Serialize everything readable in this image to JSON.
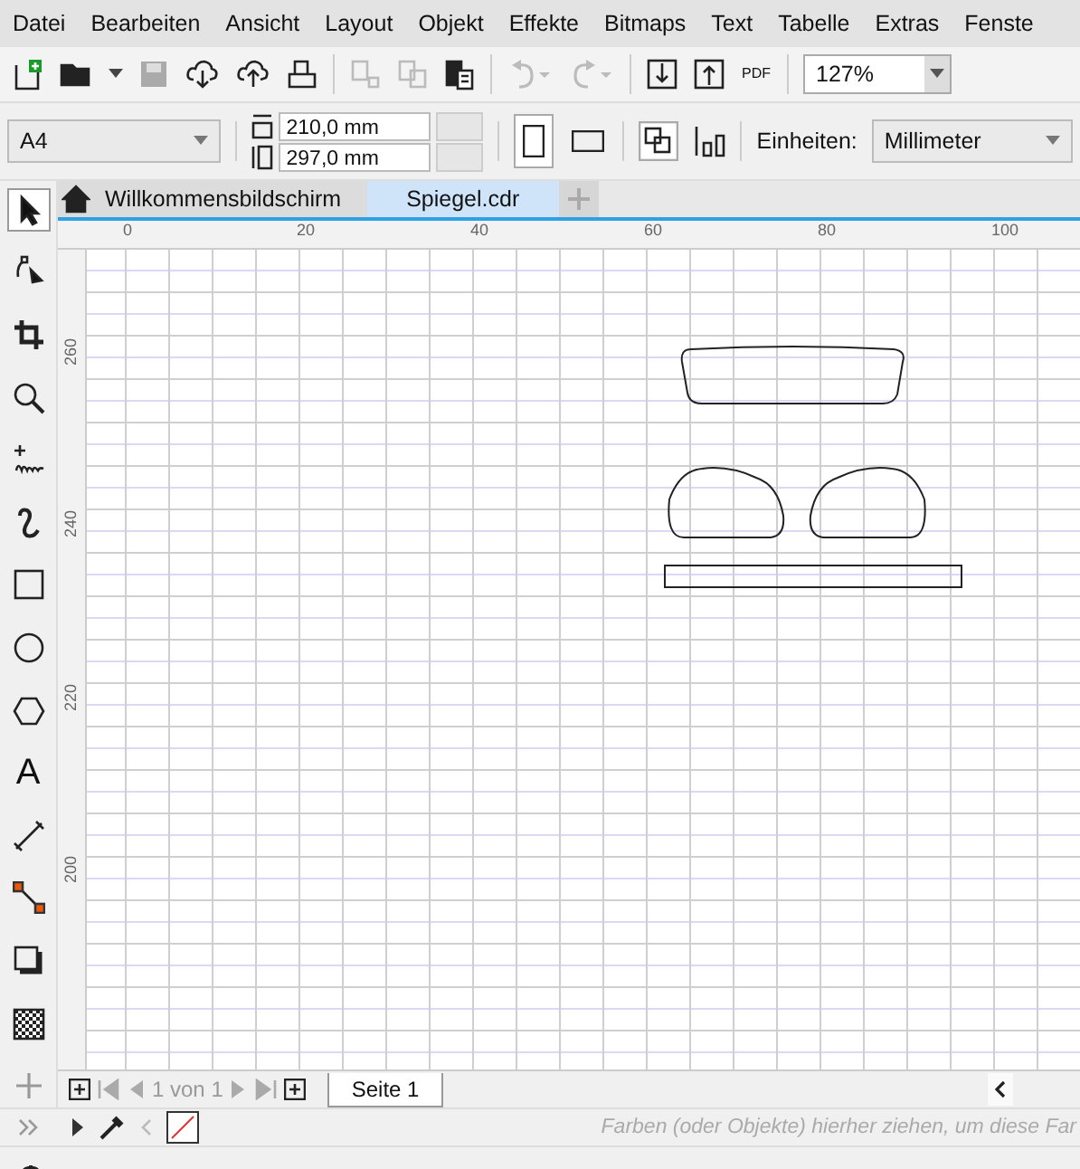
{
  "menu": [
    {
      "label": "Datei"
    },
    {
      "label": "Bearbeiten"
    },
    {
      "label": "Ansicht"
    },
    {
      "label": "Layout"
    },
    {
      "label": "Objekt"
    },
    {
      "label": "Effekte"
    },
    {
      "label": "Bitmaps"
    },
    {
      "label": "Text"
    },
    {
      "label": "Tabelle"
    },
    {
      "label": "Extras"
    },
    {
      "label": "Fenste"
    }
  ],
  "toolbar": {
    "pdf_label": "PDF",
    "zoom": "127%"
  },
  "property_bar": {
    "page_size": "A4",
    "width": "210,0 mm",
    "height": "297,0 mm",
    "orientations": [
      {
        "kind": "portrait",
        "selected": true
      },
      {
        "kind": "landscape",
        "selected": false
      }
    ],
    "units_label": "Einheiten:",
    "units": "Millimeter"
  },
  "toolbox": [
    {
      "kind": "pick",
      "selected": true
    },
    {
      "kind": "shape",
      "selected": false
    },
    {
      "kind": "crop",
      "selected": false
    },
    {
      "kind": "zoom",
      "selected": false
    },
    {
      "kind": "freehand",
      "selected": false
    },
    {
      "kind": "artistic",
      "selected": false
    },
    {
      "kind": "rectangle",
      "selected": false
    },
    {
      "kind": "ellipse",
      "selected": false
    },
    {
      "kind": "polygon",
      "selected": false
    },
    {
      "kind": "text",
      "selected": false,
      "glyph": "A"
    },
    {
      "kind": "dimension",
      "selected": false
    },
    {
      "kind": "connector",
      "selected": false
    },
    {
      "kind": "shadow",
      "selected": false
    },
    {
      "kind": "transparency",
      "selected": false
    },
    {
      "kind": "add",
      "selected": false
    }
  ],
  "tabs": [
    {
      "kind": "home",
      "label": "Willkommensbildschirm",
      "selected": false
    },
    {
      "kind": "document",
      "label": "Spiegel.cdr",
      "selected": true
    }
  ],
  "ruler": {
    "x_labels": [
      "0",
      "20",
      "40",
      "60",
      "80",
      "100"
    ],
    "y_labels": [
      "260",
      "240",
      "220",
      "200"
    ]
  },
  "page_nav": {
    "position": "1 von 1",
    "page_tab": "Seite 1"
  },
  "palette": {
    "hint": "Farben (oder Objekte) hierher ziehen, um diese Far"
  }
}
